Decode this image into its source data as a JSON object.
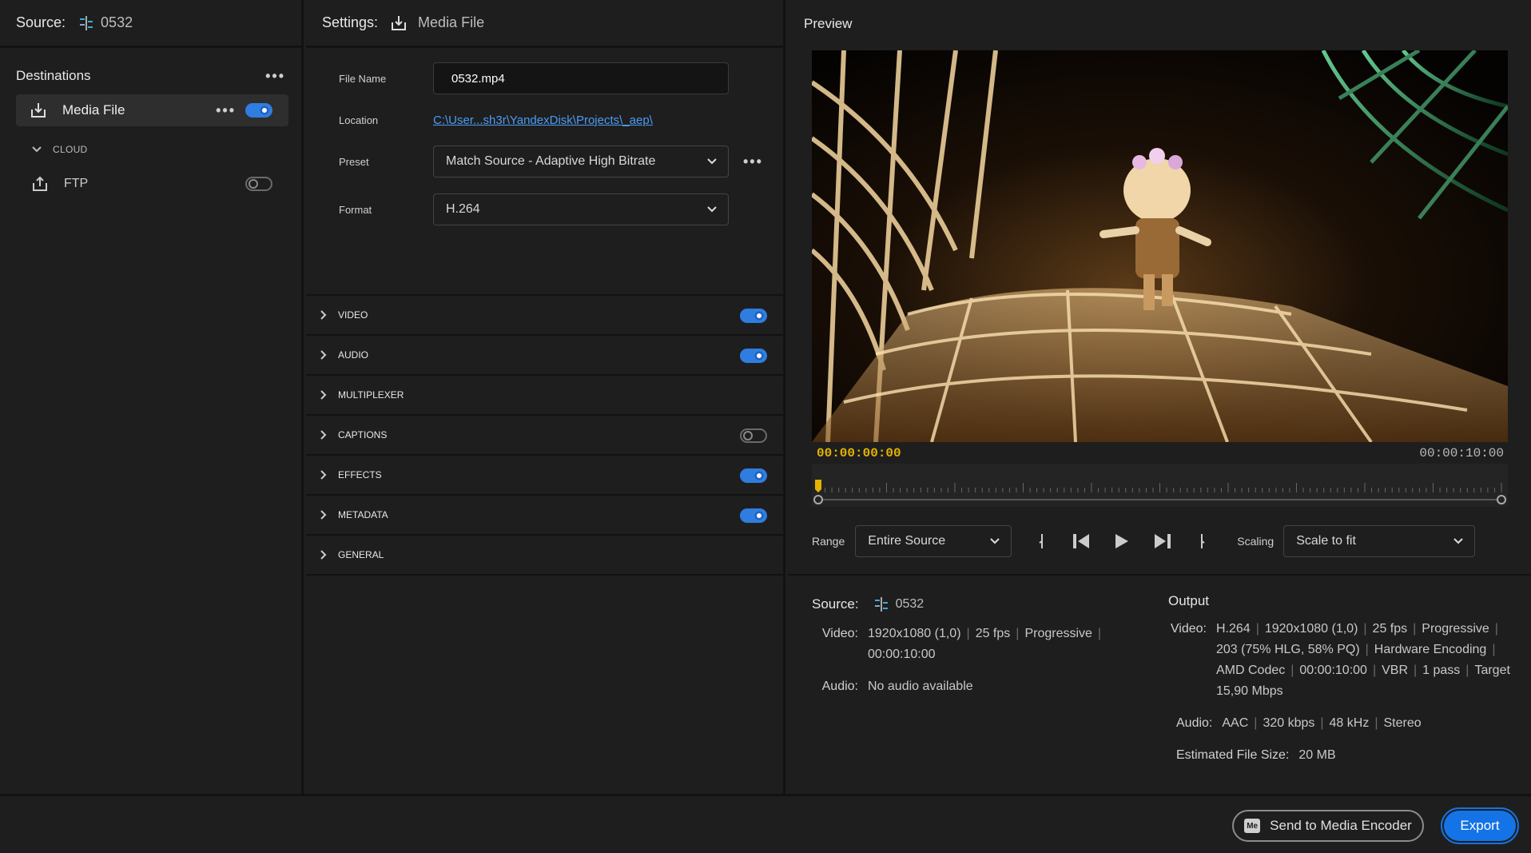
{
  "left": {
    "source_label": "Source:",
    "source_name": "0532",
    "destinations_title": "Destinations",
    "more": "•••",
    "media_file": {
      "label": "Media File",
      "enabled": true
    },
    "cloud_label": "CLOUD",
    "ftp": {
      "label": "FTP",
      "enabled": false
    }
  },
  "middle": {
    "settings_label": "Settings:",
    "settings_target": "Media File",
    "file_name_label": "File Name",
    "file_name_value": "0532.mp4",
    "location_label": "Location",
    "location_value": "C:\\User...sh3r\\YandexDisk\\Projects\\_aep\\",
    "preset_label": "Preset",
    "preset_value": "Match Source - Adaptive High Bitrate",
    "format_label": "Format",
    "format_value": "H.264",
    "more": "•••",
    "sections": [
      {
        "label": "VIDEO",
        "toggle": "on"
      },
      {
        "label": "AUDIO",
        "toggle": "on"
      },
      {
        "label": "MULTIPLEXER",
        "toggle": "none"
      },
      {
        "label": "CAPTIONS",
        "toggle": "off"
      },
      {
        "label": "EFFECTS",
        "toggle": "on"
      },
      {
        "label": "METADATA",
        "toggle": "on"
      },
      {
        "label": "GENERAL",
        "toggle": "none"
      }
    ]
  },
  "preview": {
    "title": "Preview",
    "time_start": "00:00:00:00",
    "time_end": "00:00:10:00",
    "playhead_fraction": 0.0,
    "range_label": "Range",
    "range_value": "Entire Source",
    "scaling_label": "Scaling",
    "scaling_value": "Scale to fit"
  },
  "summary": {
    "source_label": "Source:",
    "source_name": "0532",
    "source_video_label": "Video:",
    "source_video_line1": [
      "1920x1080 (1,0)",
      "25 fps",
      "Progressive"
    ],
    "source_video_line2": "00:00:10:00",
    "source_audio_label": "Audio:",
    "source_audio_value": "No audio available",
    "output_label": "Output",
    "output_video_label": "Video:",
    "output_video_line1": [
      "H.264",
      "1920x1080 (1,0)",
      "25 fps",
      "Progressive"
    ],
    "output_video_line2": [
      "203 (75% HLG, 58% PQ)",
      "Hardware Encoding"
    ],
    "output_video_line3": [
      "AMD Codec",
      "00:00:10:00",
      "VBR",
      "1 pass",
      "Target"
    ],
    "output_video_line4": "15,90 Mbps",
    "output_audio_label": "Audio:",
    "output_audio_values": [
      "AAC",
      "320 kbps",
      "48 kHz",
      "Stereo"
    ],
    "file_size_label": "Estimated File Size:",
    "file_size_value": "20 MB"
  },
  "footer": {
    "send_label": "Send to Media Encoder",
    "me_badge": "Me",
    "export_label": "Export"
  },
  "colors": {
    "accent": "#1473e6",
    "toggle_on": "#2f7de1",
    "timecode": "#e5b400",
    "link": "#4b9cf5"
  }
}
